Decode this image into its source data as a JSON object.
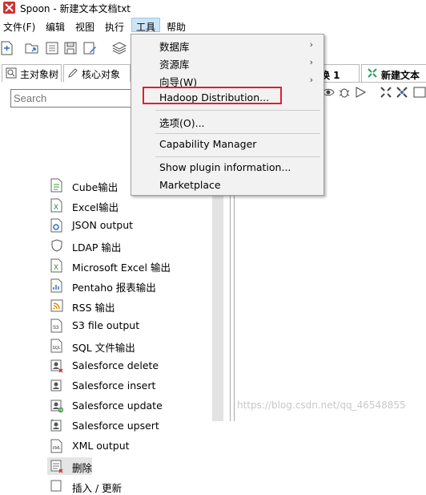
{
  "window": {
    "title": "Spoon - 新建文本文档txt"
  },
  "menubar": {
    "items": [
      "文件(F)",
      "编辑",
      "视图",
      "执行",
      "工具",
      "帮助"
    ]
  },
  "left_panel": {
    "tabs": [
      "主对象树",
      "核心对象"
    ],
    "search_placeholder": "Search",
    "items": [
      "Cube输出",
      "Excel输出",
      "JSON output",
      "LDAP 输出",
      "Microsoft Excel 输出",
      "Pentaho 报表输出",
      "RSS 输出",
      "S3 file output",
      "SQL 文件输出",
      "Salesforce delete",
      "Salesforce insert",
      "Salesforce update",
      "Salesforce upsert",
      "XML output",
      "删除",
      "插入 / 更新"
    ]
  },
  "right_panel": {
    "tabs": [
      "换 1",
      "新建文本文"
    ]
  },
  "tools_menu": {
    "items": [
      {
        "label": "数据库",
        "submenu": true
      },
      {
        "label": "资源库",
        "submenu": true
      },
      {
        "label": "向导(W)",
        "submenu": true
      },
      {
        "label": "Hadoop Distribution...",
        "submenu": false
      },
      {
        "label": "选项(O)...",
        "submenu": false
      },
      {
        "label": "Capability Manager",
        "submenu": false
      },
      {
        "label": "Show plugin information...",
        "submenu": false
      },
      {
        "label": "Marketplace",
        "submenu": false
      }
    ]
  },
  "watermark": "https://blog.csdn.net/qq_46548855",
  "colors": {
    "highlight": "#e0202a",
    "menu_active": "#cce4f7",
    "menu_bg": "#f2f2f2"
  }
}
